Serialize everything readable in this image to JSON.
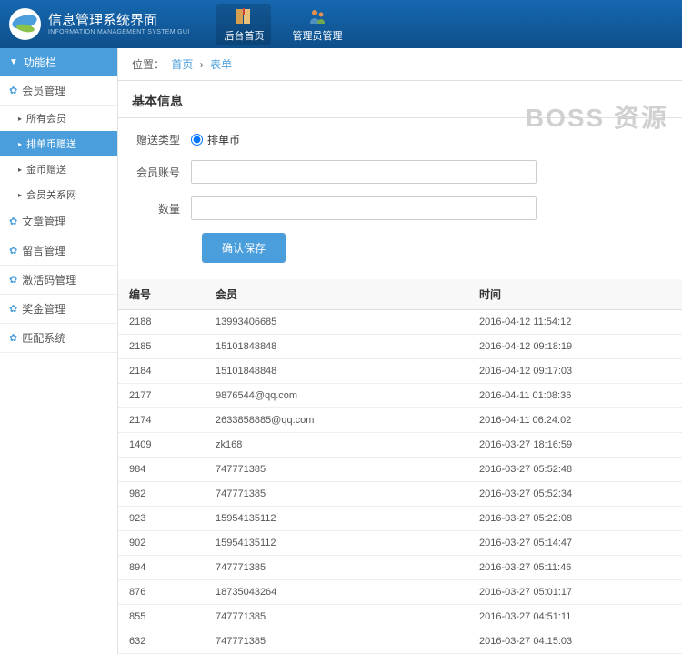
{
  "header": {
    "title": "信息管理系统界面",
    "subtitle": "INFORMATION MANAGEMENT SYSTEM GUI"
  },
  "nav": [
    {
      "label": "后台首页"
    },
    {
      "label": "管理员管理"
    }
  ],
  "watermark": "BOSS 资源",
  "sidebar": {
    "title": "功能栏",
    "items": [
      {
        "label": "会员管理",
        "expanded": true
      },
      {
        "label": "文章管理"
      },
      {
        "label": "留言管理"
      },
      {
        "label": "激活码管理"
      },
      {
        "label": "奖金管理"
      },
      {
        "label": "匹配系统"
      }
    ],
    "submenu": [
      {
        "label": "所有会员"
      },
      {
        "label": "排单币赠送",
        "active": true
      },
      {
        "label": "金币赠送"
      },
      {
        "label": "会员关系网"
      }
    ]
  },
  "breadcrumb": {
    "label": "位置：",
    "home": "首页",
    "current": "表单"
  },
  "section_title": "基本信息",
  "form": {
    "type_label": "赠送类型",
    "type_option": "排单币",
    "account_label": "会员账号",
    "qty_label": "数量",
    "submit": "确认保存"
  },
  "table": {
    "headers": [
      "编号",
      "会员",
      "时间"
    ],
    "rows": [
      [
        "2188",
        "13993406685",
        "2016-04-12 11:54:12"
      ],
      [
        "2185",
        "15101848848",
        "2016-04-12 09:18:19"
      ],
      [
        "2184",
        "15101848848",
        "2016-04-12 09:17:03"
      ],
      [
        "2177",
        "9876544@qq.com",
        "2016-04-11 01:08:36"
      ],
      [
        "2174",
        "2633858885@qq.com",
        "2016-04-11 06:24:02"
      ],
      [
        "1409",
        "zk168",
        "2016-03-27 18:16:59"
      ],
      [
        "984",
        "747771385",
        "2016-03-27 05:52:48"
      ],
      [
        "982",
        "747771385",
        "2016-03-27 05:52:34"
      ],
      [
        "923",
        "15954135112",
        "2016-03-27 05:22:08"
      ],
      [
        "902",
        "15954135112",
        "2016-03-27 05:14:47"
      ],
      [
        "894",
        "747771385",
        "2016-03-27 05:11:46"
      ],
      [
        "876",
        "18735043264",
        "2016-03-27 05:01:17"
      ],
      [
        "855",
        "747771385",
        "2016-03-27 04:51:11"
      ],
      [
        "632",
        "747771385",
        "2016-03-27 04:15:03"
      ]
    ]
  }
}
